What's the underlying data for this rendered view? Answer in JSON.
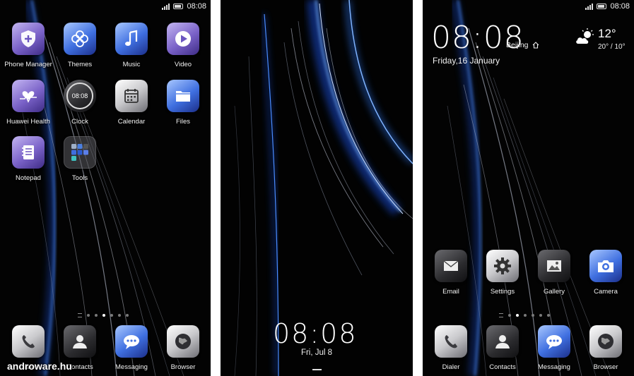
{
  "status": {
    "time": "08:08"
  },
  "left_home": {
    "apps": [
      {
        "label": "Phone Manager",
        "icon": "shield-icon"
      },
      {
        "label": "Themes",
        "icon": "themes-icon"
      },
      {
        "label": "Music",
        "icon": "music-note-icon"
      },
      {
        "label": "Video",
        "icon": "play-icon"
      },
      {
        "label": "Huawei Health",
        "icon": "heart-icon"
      },
      {
        "label": "Clock",
        "icon": "clock-icon",
        "clock_text": "08:08"
      },
      {
        "label": "Calendar",
        "icon": "calendar-icon"
      },
      {
        "label": "Files",
        "icon": "folder-icon"
      },
      {
        "label": "Notepad",
        "icon": "notepad-icon"
      },
      {
        "label": "Tools",
        "icon": "tools-folder-icon"
      }
    ],
    "dock": [
      {
        "label": "Dialer",
        "icon": "phone-icon"
      },
      {
        "label": "Contacts",
        "icon": "contacts-icon"
      },
      {
        "label": "Messaging",
        "icon": "message-icon"
      },
      {
        "label": "Browser",
        "icon": "globe-icon"
      }
    ],
    "page_count": 6,
    "active_page": 3
  },
  "lock_screen": {
    "time": "08:08",
    "date": "Fri, Jul 8"
  },
  "right_home": {
    "time": "08:08",
    "city": "Beijing",
    "date": "Friday,16 January",
    "temperature": "12°",
    "range": "20° / 10°",
    "apps": [
      {
        "label": "Email",
        "icon": "envelope-icon"
      },
      {
        "label": "Settings",
        "icon": "gear-icon"
      },
      {
        "label": "Gallery",
        "icon": "image-icon"
      },
      {
        "label": "Camera",
        "icon": "camera-icon"
      }
    ],
    "dock": [
      {
        "label": "Dialer",
        "icon": "phone-icon"
      },
      {
        "label": "Contacts",
        "icon": "contacts-icon"
      },
      {
        "label": "Messaging",
        "icon": "message-icon"
      },
      {
        "label": "Browser",
        "icon": "globe-icon"
      }
    ],
    "page_count": 6,
    "active_page": 2
  },
  "watermark": "androware.hu",
  "colors": {
    "accent_blue": "#2a6cff",
    "wallpaper": "#030303"
  }
}
